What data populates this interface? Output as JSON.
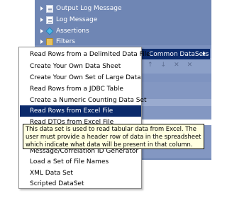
{
  "tree": {
    "rows": [
      {
        "label": "Output Log Message",
        "icon": "document-icon"
      },
      {
        "label": "Log Message",
        "icon": "document-icon"
      },
      {
        "label": "Assertions",
        "icon": "diamond-icon"
      },
      {
        "label": "Filters",
        "icon": "folder-icon"
      }
    ]
  },
  "toolbar": {
    "icons": [
      "↑",
      "↓",
      "✕",
      "✕"
    ]
  },
  "submenu": {
    "label": "Common DataSets"
  },
  "menu": {
    "items": [
      "Read Rows from a Delimited Data File",
      "Create Your Own Data Sheet",
      "Create Your Own Set of Large Data",
      "Read Rows from a JDBC Table",
      "Create a Numeric Counting Data Set",
      "Read Rows from Excel File",
      "Read DTOs from Excel File",
      "Message/Correlation ID Generator",
      "Load a Set of File Names",
      "XML Data Set",
      "Scripted DataSet"
    ],
    "selected_index": 5
  },
  "tooltip": {
    "lines": [
      "This data set is used to read tabular data from Excel. The",
      "user must provide a header row of data in the spreadsheet",
      "which indicate what data will be present in that column."
    ]
  },
  "colors": {
    "panel": "#6f86b4",
    "selection": "#0b2a6b",
    "tooltip_bg": "#ffffe1"
  }
}
